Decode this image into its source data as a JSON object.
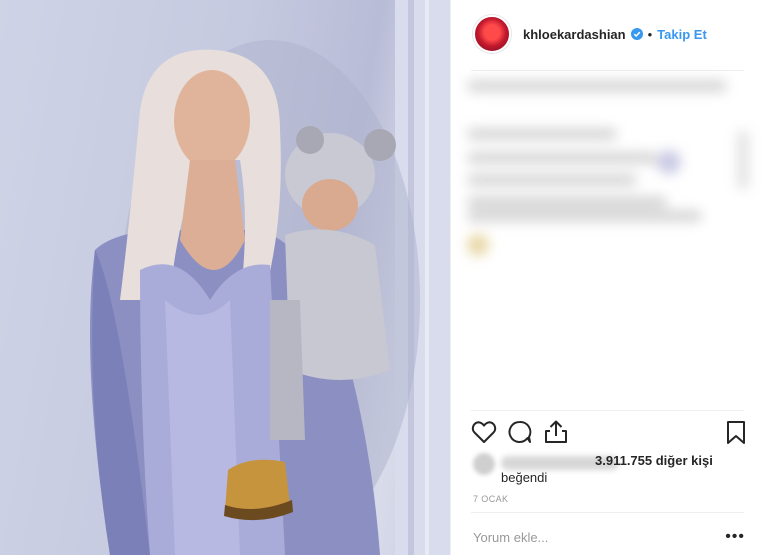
{
  "post": {
    "username": "khloekardashian",
    "verified": true,
    "separator": "•",
    "follow_label": "Takip Et",
    "like_count_text": "3.911.755 diğer kişi",
    "liked_text": "beğendi",
    "date": "7 OCAK",
    "comment_placeholder": "Yorum ekle...",
    "more_options": "•••"
  },
  "colors": {
    "follow_blue": "#3897f0",
    "verified_blue": "#3897f0",
    "text_dark": "#262626",
    "text_gray": "#999999",
    "divider": "#efefef"
  },
  "icons": [
    "heart-icon",
    "comment-icon",
    "share-icon",
    "bookmark-icon",
    "verified-badge-icon",
    "more-options-icon"
  ]
}
